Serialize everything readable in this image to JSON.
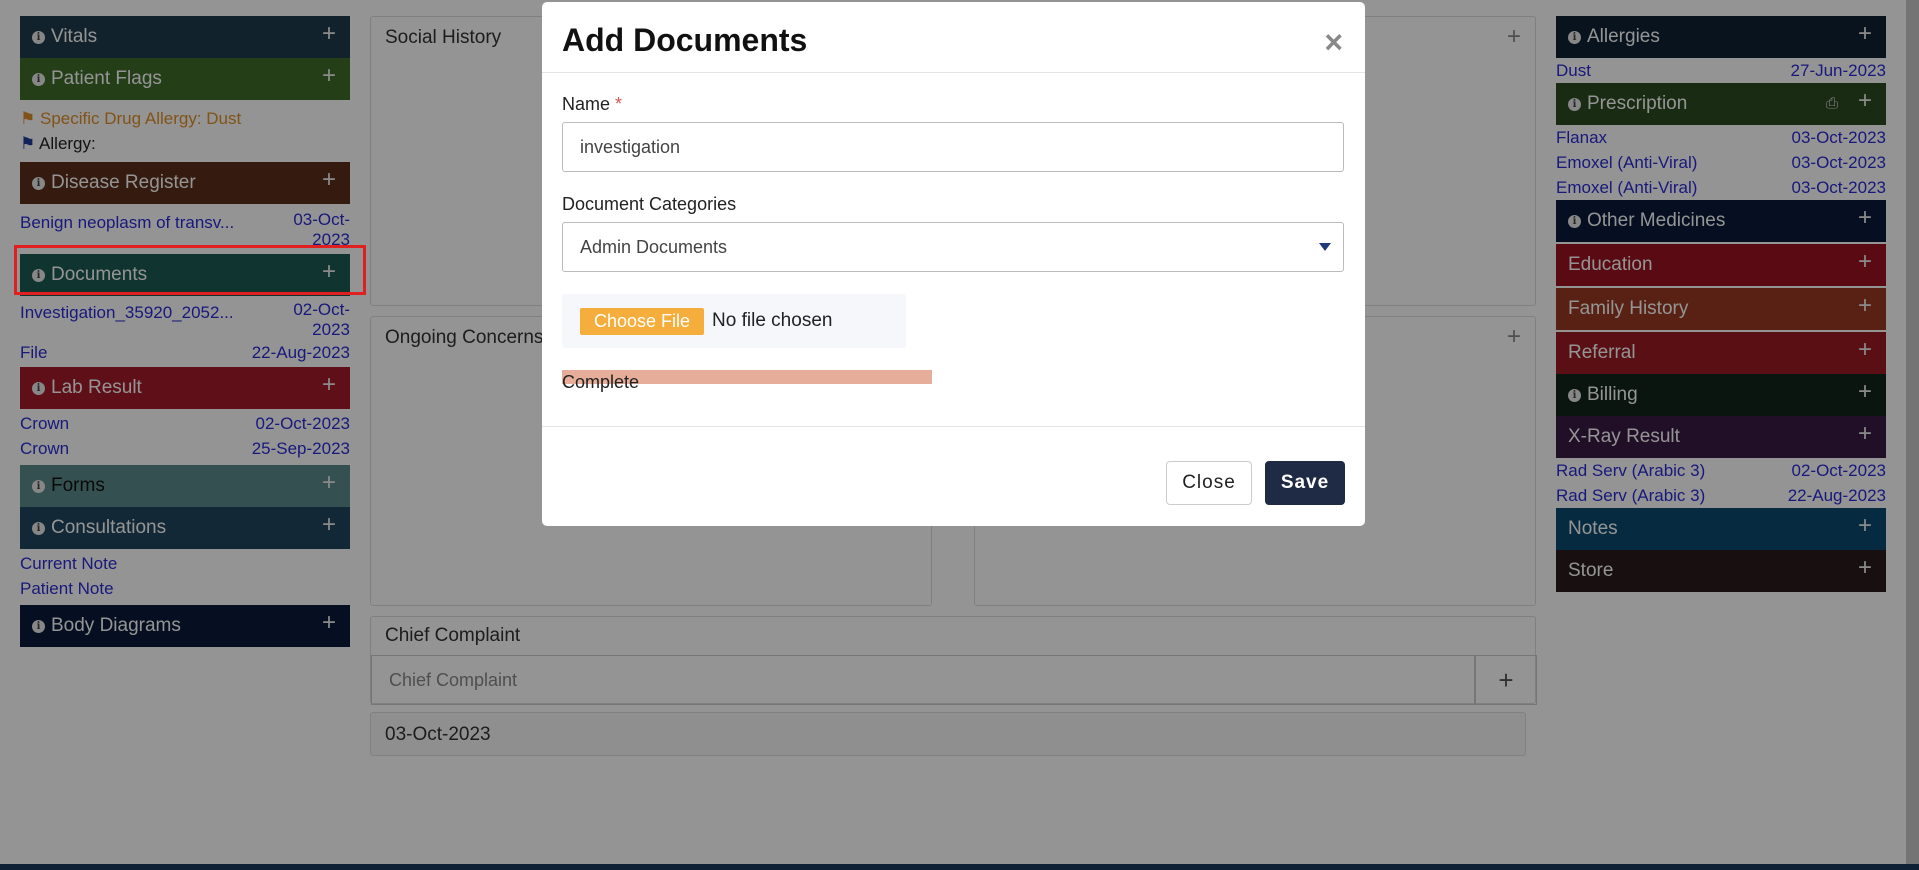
{
  "left": {
    "vitals": "Vitals",
    "patient_flags": "Patient Flags",
    "flag1": "Specific Drug Allergy: Dust",
    "flag2": "Allergy:",
    "disease_register": "Disease Register",
    "disease_item": "Benign neoplasm of transv...",
    "disease_date_a": "03-Oct-",
    "disease_date_b": "2023",
    "documents": "Documents",
    "doc1": "Investigation_35920_2052...",
    "doc1_date_a": "02-Oct-",
    "doc1_date_b": "2023",
    "doc2": "File",
    "doc2_date": "22-Aug-2023",
    "lab_result": "Lab Result",
    "lab1": "Crown",
    "lab1_date": "02-Oct-2023",
    "lab2": "Crown",
    "lab2_date": "25-Sep-2023",
    "forms": "Forms",
    "consultations": "Consultations",
    "cons1": "Current Note",
    "cons2": "Patient Note",
    "body_diagrams": "Body Diagrams"
  },
  "center": {
    "social_history": "Social History",
    "ongoing_concerns": "Ongoing Concerns",
    "chief_complaint_title": "Chief Complaint",
    "chief_complaint_placeholder": "Chief Complaint",
    "date": "03-Oct-2023"
  },
  "right": {
    "allergies": "Allergies",
    "allergy1": "Dust",
    "allergy1_date": "27-Jun-2023",
    "prescription": "Prescription",
    "rx1": "Flanax",
    "rx1_date": "03-Oct-2023",
    "rx2": "Emoxel (Anti-Viral)",
    "rx2_date": "03-Oct-2023",
    "rx3": "Emoxel (Anti-Viral)",
    "rx3_date": "03-Oct-2023",
    "other_medicines": "Other Medicines",
    "education": "Education",
    "family_history": "Family History",
    "referral": "Referral",
    "billing": "Billing",
    "xray": "X-Ray Result",
    "xray1": "Rad Serv (Arabic 3)",
    "xray1_date": "02-Oct-2023",
    "xray2": "Rad Serv (Arabic 3)",
    "xray2_date": "22-Aug-2023",
    "notes": "Notes",
    "store": "Store"
  },
  "modal": {
    "title": "Add Documents",
    "close_x": "×",
    "name_label": "Name",
    "required_mark": "*",
    "name_value": "investigation",
    "category_label": "Document Categories",
    "category_value": "Admin Documents",
    "choose_file": "Choose File",
    "no_file": "No file chosen",
    "progress_label": "Complete",
    "progress_value": 1.0,
    "close_btn": "Close",
    "save_btn": "Save"
  },
  "colors": {
    "vitals": "#1f3b4d",
    "patient_flags": "#3f6b2a",
    "disease_register": "#5a2e1a",
    "documents": "#1d5a52",
    "lab_result": "#a31a2a",
    "forms": "#5a8a8a",
    "consultations": "#1f4560",
    "body_diagrams": "#0a1a3a",
    "allergies": "#0f2233",
    "prescription": "#2b4a20",
    "other_medicines": "#0a1a3a",
    "education": "#9a1220",
    "family_history": "#9a3a22",
    "referral": "#9a1a22",
    "billing": "#14251a",
    "xray": "#3a1a45",
    "notes": "#0c4a70",
    "store": "#2a1a1e"
  }
}
